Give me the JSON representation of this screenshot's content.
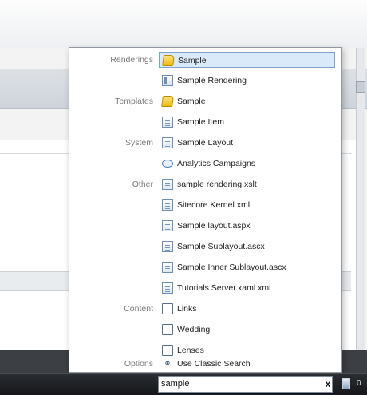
{
  "search": {
    "value": "sample",
    "clear_label": "x"
  },
  "tray": {
    "text": "0"
  },
  "groups": [
    {
      "category": "Renderings",
      "items": [
        {
          "label": "Sample",
          "icon": "folder-icon",
          "selected": true
        },
        {
          "label": "Sample Rendering",
          "icon": "rendering-icon"
        }
      ]
    },
    {
      "category": "Templates",
      "items": [
        {
          "label": "Sample",
          "icon": "folder-icon"
        },
        {
          "label": "Sample Item",
          "icon": "document-icon"
        }
      ]
    },
    {
      "category": "System",
      "items": [
        {
          "label": "Sample Layout",
          "icon": "document-icon"
        },
        {
          "label": "Analytics Campaigns",
          "icon": "campaign-icon"
        }
      ]
    },
    {
      "category": "Other",
      "items": [
        {
          "label": "sample rendering.xslt",
          "icon": "file-icon"
        },
        {
          "label": "Sitecore.Kernel.xml",
          "icon": "file-icon"
        },
        {
          "label": "Sample layout.aspx",
          "icon": "file-icon"
        },
        {
          "label": "Sample Sublayout.ascx",
          "icon": "file-icon"
        },
        {
          "label": "Sample Inner Sublayout.ascx",
          "icon": "file-icon"
        },
        {
          "label": "Tutorials.Server.xaml.xml",
          "icon": "file-icon"
        }
      ]
    },
    {
      "category": "Content",
      "items": [
        {
          "label": "Links",
          "icon": "page-icon"
        },
        {
          "label": "Wedding",
          "icon": "page-icon"
        },
        {
          "label": "Lenses",
          "icon": "page-icon"
        }
      ]
    },
    {
      "category": "Options",
      "items": [
        {
          "label": "Use Classic Search",
          "icon": "classic-search-icon"
        }
      ]
    }
  ],
  "colors": {
    "selected_bg": "#dbeaf8",
    "selected_border": "#7da2ce",
    "category_text": "#7a7a7a",
    "taskbar": "#15171a"
  }
}
